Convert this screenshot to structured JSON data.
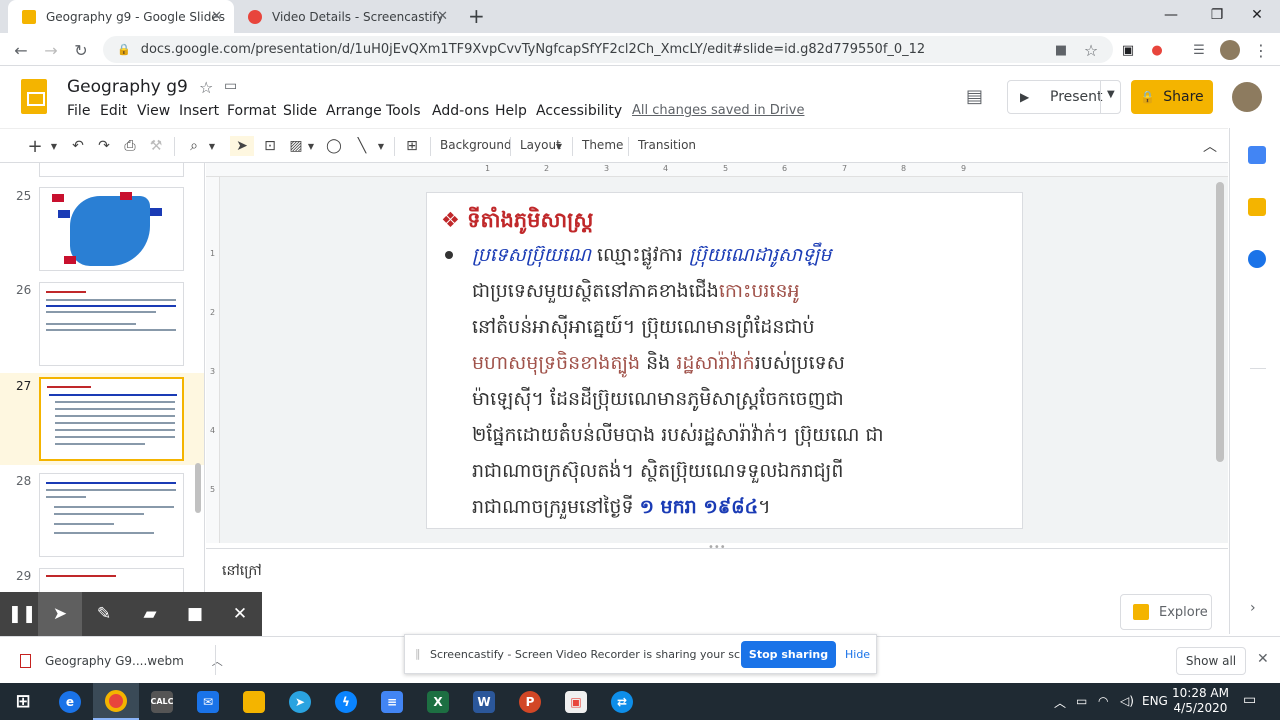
{
  "browser": {
    "tabs": [
      {
        "title": "Geography g9 - Google Slides",
        "color": "#f4b400"
      },
      {
        "title": "Video Details - Screencastify",
        "color": "#e8453c"
      }
    ],
    "url": "docs.google.com/presentation/d/1uH0jEvQXm1TF9XvpCvvTyNgfcapSfYF2cl2Ch_XmcLY/edit#slide=id.g82d779550f_0_12"
  },
  "docs": {
    "title": "Geography g9",
    "menus": [
      "File",
      "Edit",
      "View",
      "Insert",
      "Format",
      "Slide",
      "Arrange",
      "Tools",
      "Add-ons",
      "Help",
      "Accessibility"
    ],
    "saved": "All changes saved in Drive",
    "present": "Present",
    "share": "Share"
  },
  "toolbar": {
    "background": "Background",
    "layout": "Layout",
    "theme": "Theme",
    "transition": "Transition"
  },
  "filmstrip": {
    "slides": [
      "25",
      "26",
      "27",
      "28",
      "29"
    ]
  },
  "ruler": {
    "top": [
      "1",
      "2",
      "3",
      "4",
      "5",
      "6",
      "7",
      "8",
      "9"
    ],
    "left": [
      "1",
      "2",
      "3",
      "4",
      "5"
    ]
  },
  "slide": {
    "heading": "❖  ទីតាំងភូមិសាស្ត្រ",
    "lines": [
      {
        "a": "ប្រទេសប៊្រុយណេ",
        "b": " ឈ្មោះផ្លូវការ ",
        "c": "ប៊្រុយណេដារូសាឡឹម"
      },
      {
        "a": "ជាប្រទេសមួយស្ថិតនៅភាគខាងជើង",
        "b": "កោះបរនេអូ"
      },
      {
        "a": "នៅតំបន់អាស៊ីអាគ្នេយ៍។ ប៊្រុយណេមានព្រំដែនជាប់"
      },
      {
        "a": "មហាសមុទ្រចិនខាងត្បូង",
        "b": " និង ",
        "c": "រដ្ឋសារ៉ាវ៉ាក់",
        "d": "របស់ប្រទេស"
      },
      {
        "a": "ម៉ាឡេស៊ី។ ដែនដីប៊្រុយណេមានភូមិសាស្ត្រចែកចេញជា"
      },
      {
        "a": "២ផ្នែកដោយតំបន់លីមបាង របស់រដ្ឋសារ៉ាវ៉ាក់។ ប៊្រុយណេ ជា"
      },
      {
        "a": "រាជាណាចក្រស៊ុលតង់។ ស្ថិតប៊្រុយណេទទួលឯករាជ្យពី"
      },
      {
        "a": "រាជាណាចក្ររួមនៅថ្ងៃទី ",
        "b": "១ មករា ១៩៨៤",
        "c": "។"
      }
    ]
  },
  "notes": "នៅក្រៅ",
  "explore": "Explore",
  "screencastify": {
    "message": "Screencastify - Screen Video Recorder is sharing your screen.",
    "stop": "Stop sharing",
    "hide": "Hide"
  },
  "downloads": {
    "file": "Geography  G9....webm",
    "show_all": "Show all"
  },
  "taskbar": {
    "lang": "ENG",
    "time": "10:28 AM",
    "date": "4/5/2020"
  }
}
